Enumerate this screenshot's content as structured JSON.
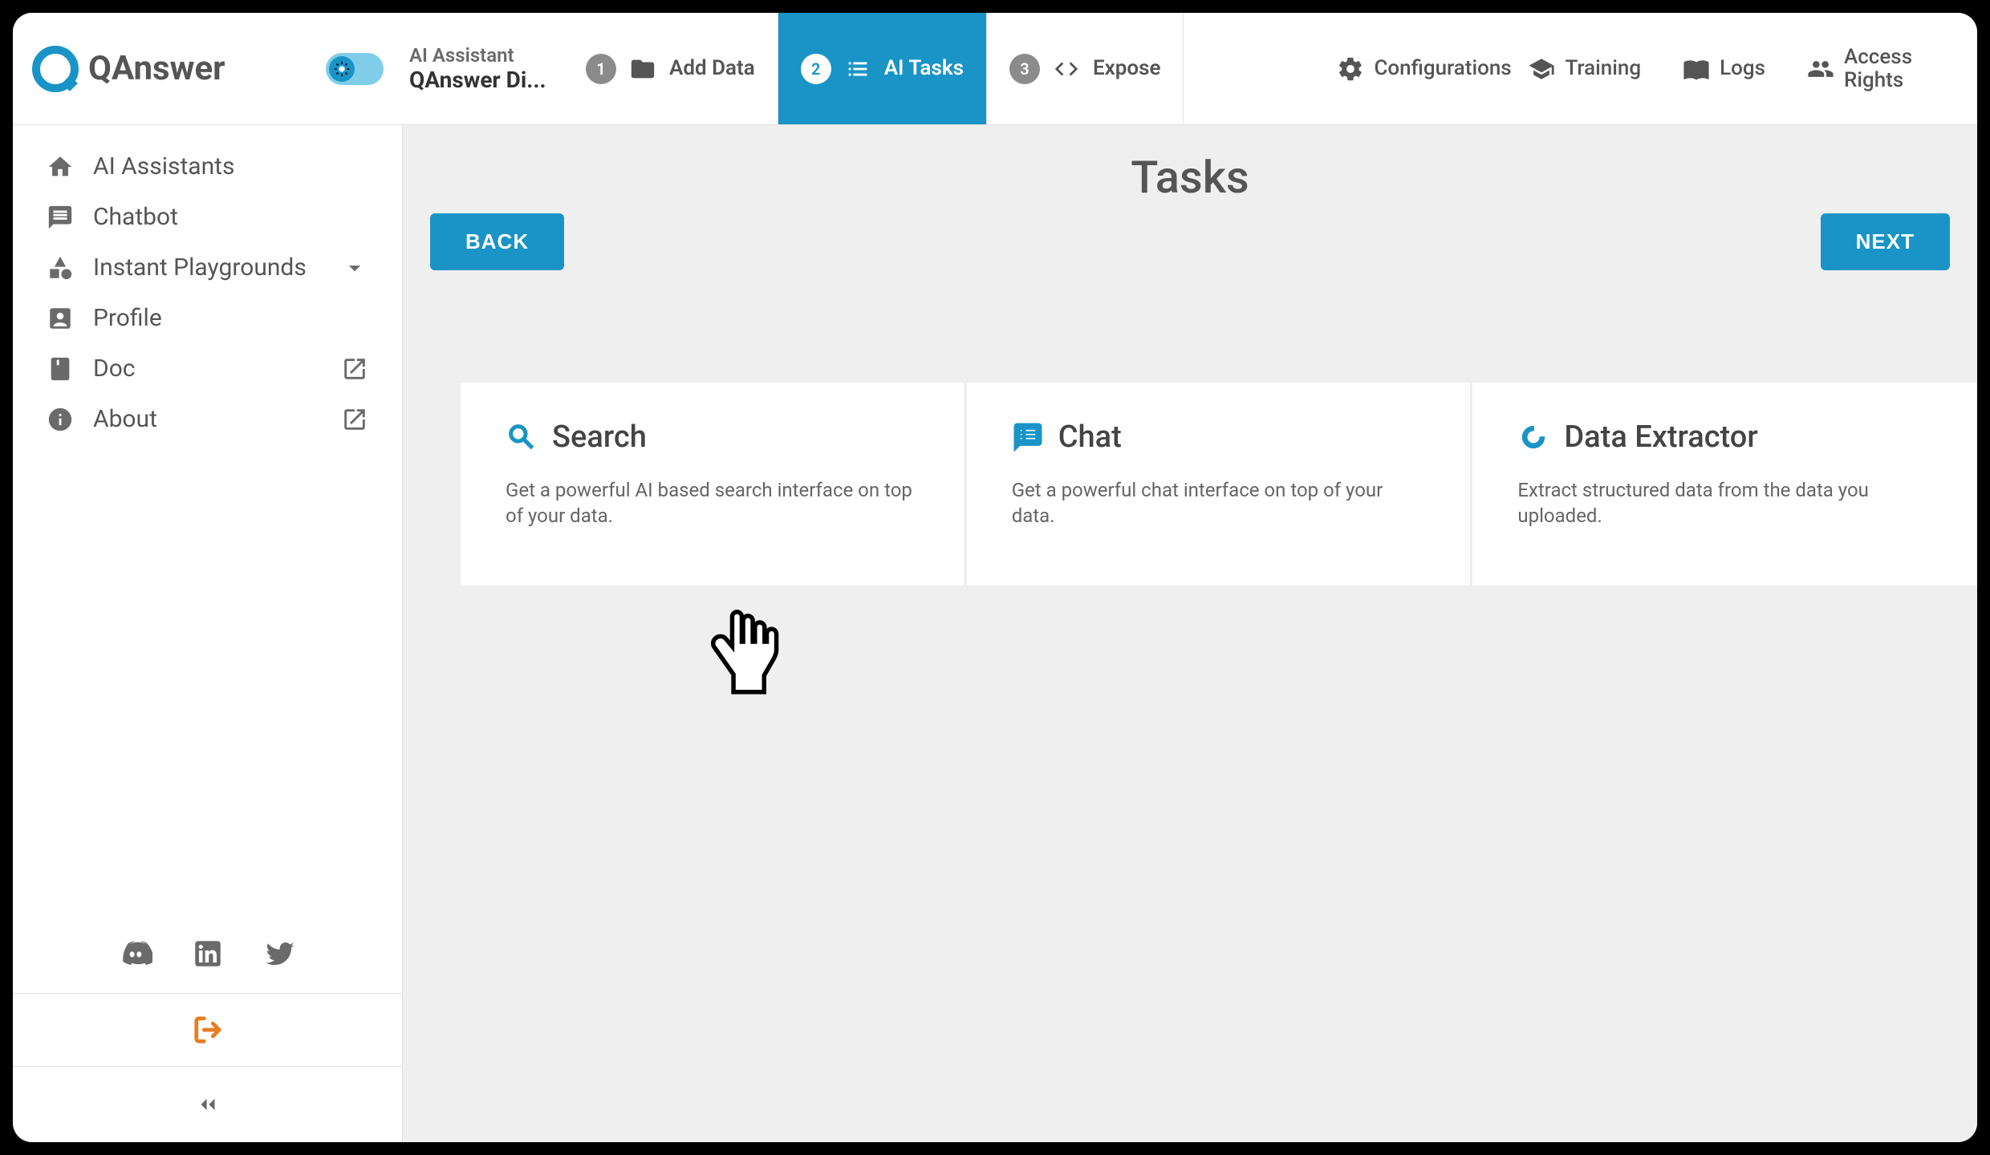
{
  "brand": "QAnswer",
  "breadcrumb": {
    "parent": "AI Assistant",
    "current": "QAnswer Di..."
  },
  "steps": [
    {
      "num": "1",
      "label": "Add Data",
      "icon": "folder"
    },
    {
      "num": "2",
      "label": "AI Tasks",
      "icon": "list"
    },
    {
      "num": "3",
      "label": "Expose",
      "icon": "code"
    }
  ],
  "top_actions": [
    {
      "label": "Configurations",
      "icon": "gear"
    },
    {
      "label": "Training",
      "icon": "grad"
    },
    {
      "label": "Logs",
      "icon": "book"
    },
    {
      "label": "Access Rights",
      "icon": "people"
    }
  ],
  "sidebar": [
    {
      "label": "AI Assistants",
      "icon": "home"
    },
    {
      "label": "Chatbot",
      "icon": "chat"
    },
    {
      "label": "Instant Playgrounds",
      "icon": "shapes",
      "chevron": true
    },
    {
      "label": "Profile",
      "icon": "person"
    },
    {
      "label": "Doc",
      "icon": "docbook",
      "external": true
    },
    {
      "label": "About",
      "icon": "info",
      "external": true
    }
  ],
  "page": {
    "title": "Tasks",
    "back": "BACK",
    "next": "NEXT"
  },
  "cards": [
    {
      "icon": "search",
      "title": "Search",
      "desc": "Get a powerful AI based search interface on top of your data."
    },
    {
      "icon": "chatfill",
      "title": "Chat",
      "desc": "Get a powerful chat interface on top of your data."
    },
    {
      "icon": "ring",
      "title": "Data Extractor",
      "desc": "Extract structured data from the data you uploaded."
    }
  ]
}
